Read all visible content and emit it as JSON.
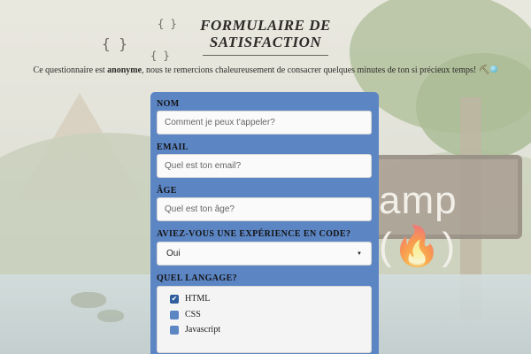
{
  "header": {
    "title": "FORMULAIRE DE SATISFACTION",
    "intro_prefix": "Ce questionnaire est ",
    "intro_bold": "anonyme",
    "intro_suffix": ", nous te remercions chaleureusement de consacrer quelques minutes de ton si précieux temps!"
  },
  "background": {
    "sign_text": "freeCodeCamp (🔥)"
  },
  "form": {
    "name": {
      "label": "NOM",
      "placeholder": "Comment je peux t'appeler?"
    },
    "email": {
      "label": "EMAIL",
      "placeholder": "Quel est ton email?"
    },
    "age": {
      "label": "ÂGE",
      "placeholder": "Quel est ton âge?"
    },
    "experience": {
      "label": "AVIEZ-VOUS UNE EXPÉRIENCE EN CODE?",
      "selected": "Oui"
    },
    "language": {
      "label": "QUEL LANGAGE?",
      "options": [
        {
          "label": "HTML",
          "checked": true
        },
        {
          "label": "CSS",
          "checked": false
        },
        {
          "label": "Javascript",
          "checked": false
        }
      ]
    }
  },
  "colors": {
    "form_background": "#5c85c4",
    "checkbox_unchecked": "#5c85c4",
    "checkbox_checked": "#2f5d9e"
  },
  "icons": [
    "pickaxe-icon",
    "gem-icon",
    "chevron-down-icon",
    "checkmark-icon"
  ]
}
